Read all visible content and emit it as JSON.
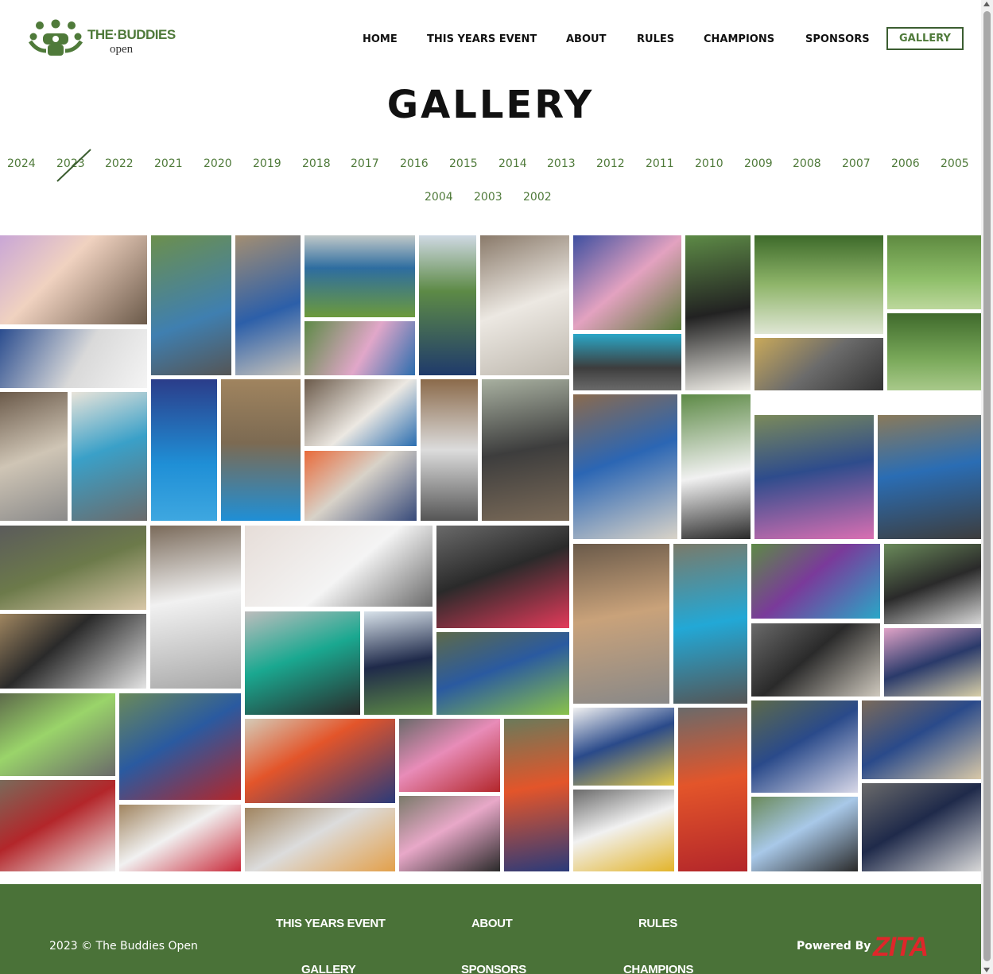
{
  "header": {
    "logo_title": "THE·BUDDIES",
    "logo_sub": "open",
    "nav": [
      {
        "label": "HOME"
      },
      {
        "label": "THIS YEARS EVENT"
      },
      {
        "label": "ABOUT"
      },
      {
        "label": "RULES"
      },
      {
        "label": "CHAMPIONS"
      },
      {
        "label": "SPONSORS"
      },
      {
        "label": "GALLERY",
        "active": true
      }
    ]
  },
  "page_title": "GALLERY",
  "years": [
    "2024",
    "2023",
    "2022",
    "2021",
    "2020",
    "2019",
    "2018",
    "2017",
    "2016",
    "2015",
    "2014",
    "2013",
    "2012",
    "2011",
    "2010",
    "2009",
    "2008",
    "2007",
    "2006",
    "2005",
    "2004",
    "2003",
    "2002"
  ],
  "selected_year": "2023",
  "colors": {
    "brand_green": "#4f7a3a",
    "footer_bg": "#4a7238",
    "zita_red": "#e0262a"
  },
  "footer": {
    "copyright": "2023 © The Buddies Open",
    "links": [
      "THIS YEARS EVENT",
      "ABOUT",
      "RULES",
      "GALLERY",
      "SPONSORS",
      "CHAMPIONS"
    ],
    "powered_by": "Powered By",
    "powered_brand": "ZITA"
  }
}
